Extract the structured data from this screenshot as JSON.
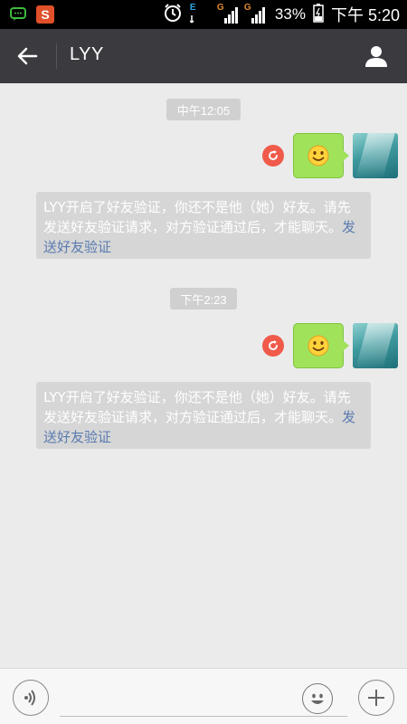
{
  "status_bar": {
    "network_1": "E",
    "network_2": "G",
    "network_3": "G",
    "battery_percent": "33%",
    "time": "下午 5:20"
  },
  "header": {
    "title": "LYY"
  },
  "chat": {
    "groups": [
      {
        "time": "中午12:05",
        "sys_text": "LYY开启了好友验证，你还不是他（她）好友。请先发送好友验证请求，对方验证通过后，才能聊天。",
        "sys_link": "发送好友验证"
      },
      {
        "time": "下午2:23",
        "sys_text": "LYY开启了好友验证，你还不是他（她）好友。请先发送好友验证请求，对方验证通过后，才能聊天。",
        "sys_link": "发送好友验证"
      }
    ]
  },
  "colors": {
    "titlebar": "#3a3a3f",
    "bubble": "#a0e25a",
    "resend": "#f05a4a",
    "link": "#5a7bb0"
  }
}
